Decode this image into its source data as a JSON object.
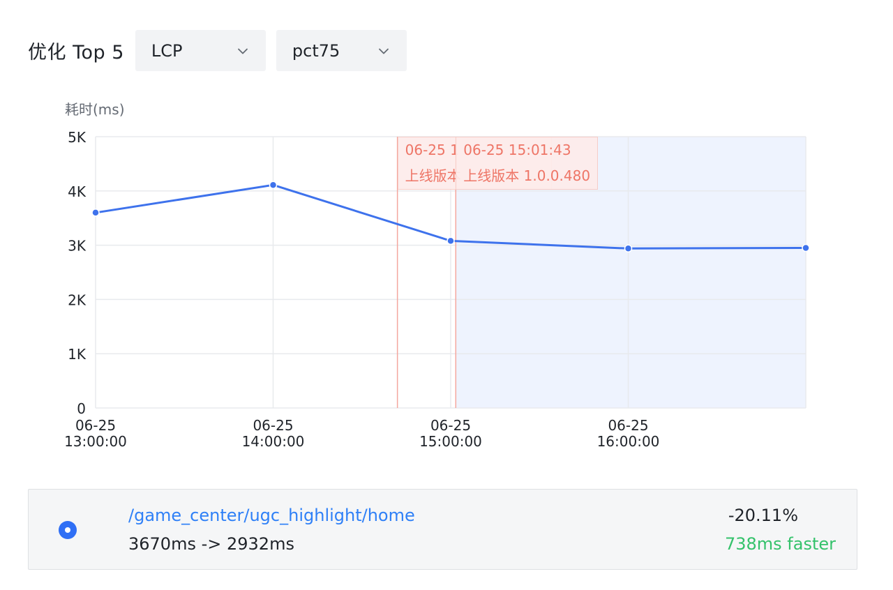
{
  "header": {
    "title": "优化 Top 5",
    "metric_select": {
      "value": "LCP"
    },
    "percentile_select": {
      "value": "pct75"
    }
  },
  "chart_data": {
    "type": "line",
    "ylabel": "耗时(ms)",
    "ylim": [
      0,
      5000
    ],
    "yticks": [
      0,
      1000,
      2000,
      3000,
      4000,
      5000
    ],
    "ytick_labels": [
      "0",
      "1K",
      "2K",
      "3K",
      "4K",
      "5K"
    ],
    "xlim": [
      "06-25 13:00:00",
      "06-25 17:00:00"
    ],
    "xticks": [
      "06-25 13:00:00",
      "06-25 14:00:00",
      "06-25 15:00:00",
      "06-25 16:00:00"
    ],
    "xtick_labels": [
      [
        "06-25",
        "13:00:00"
      ],
      [
        "06-25",
        "14:00:00"
      ],
      [
        "06-25",
        "15:00:00"
      ],
      [
        "06-25",
        "16:00:00"
      ]
    ],
    "x": [
      "06-25 13:00:00",
      "06-25 14:00:00",
      "06-25 15:00:00",
      "06-25 16:00:00",
      "06-25 17:00:00"
    ],
    "values": [
      3600,
      4110,
      3080,
      2940,
      2950
    ],
    "grid": true,
    "release_markers": [
      {
        "x": "06-25 14:42:00",
        "time_label": "06-25 1",
        "version_label": "上线版本"
      },
      {
        "x": "06-25 15:01:43",
        "time_label": "06-25 15:01:43",
        "version_label": "上线版本 1.0.0.480"
      }
    ],
    "shaded_region": [
      "06-25 15:01:43",
      "06-25 17:00:00"
    ],
    "colors": {
      "line": "#3e72ec",
      "marker_line": "#f4a79f",
      "marker_text": "#ee7566",
      "shade": "#eef3fe",
      "grid": "#e8eaed"
    }
  },
  "result_card": {
    "path": "/game_center/ugc_highlight/home",
    "timing": "3670ms -> 2932ms",
    "delta_percent": "-20.11%",
    "faster_text": "738ms faster",
    "colors": {
      "link": "#2f80f7",
      "faster": "#34c26b",
      "radio": "#2f6ff5"
    }
  }
}
